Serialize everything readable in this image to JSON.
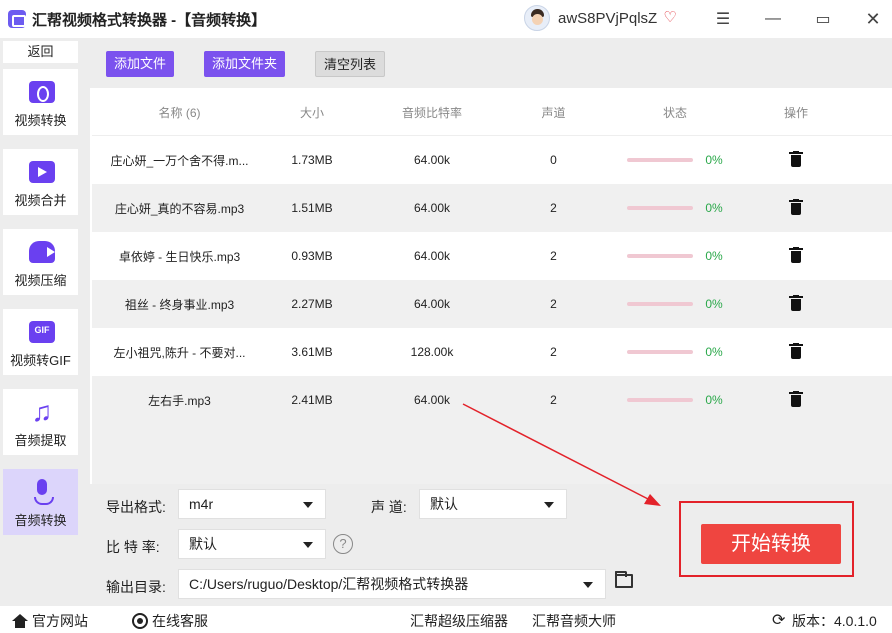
{
  "window": {
    "title": "汇帮视频格式转换器 -【音频转换】",
    "username": "awS8PVjPqlsZ",
    "icons": [
      "app-logo-icon",
      "avatar",
      "vip-heart-icon",
      "menu-icon",
      "minimize-icon",
      "maximize-icon",
      "close-icon"
    ]
  },
  "sidebar": {
    "back_label": "返回",
    "items": [
      {
        "label": "视频转换",
        "icon": "video-convert-icon"
      },
      {
        "label": "视频合并",
        "icon": "video-merge-icon"
      },
      {
        "label": "视频压缩",
        "icon": "video-compress-icon"
      },
      {
        "label": "视频转GIF",
        "icon": "gif-icon"
      },
      {
        "label": "音频提取",
        "icon": "music-note-icon"
      },
      {
        "label": "音频转换",
        "icon": "microphone-icon",
        "active": true
      }
    ]
  },
  "toolbar": {
    "add_file": "添加文件",
    "add_folder": "添加文件夹",
    "clear_list": "清空列表"
  },
  "table": {
    "headers": {
      "name": "名称 (6)",
      "size": "大小",
      "bitrate": "音频比特率",
      "channels": "声道",
      "status": "状态",
      "action": "操作"
    },
    "rows": [
      {
        "name": "庄心妍_一万个舍不得.m...",
        "size": "1.73MB",
        "bitrate": "64.00k",
        "channels": "0",
        "progress": "0%"
      },
      {
        "name": "庄心妍_真的不容易.mp3",
        "size": "1.51MB",
        "bitrate": "64.00k",
        "channels": "2",
        "progress": "0%"
      },
      {
        "name": "卓依婷 - 生日快乐.mp3",
        "size": "0.93MB",
        "bitrate": "64.00k",
        "channels": "2",
        "progress": "0%"
      },
      {
        "name": "祖丝 - 终身事业.mp3",
        "size": "2.27MB",
        "bitrate": "64.00k",
        "channels": "2",
        "progress": "0%"
      },
      {
        "name": "左小祖咒,陈升 - 不要对...",
        "size": "3.61MB",
        "bitrate": "128.00k",
        "channels": "2",
        "progress": "0%"
      },
      {
        "name": "左右手.mp3",
        "size": "2.41MB",
        "bitrate": "64.00k",
        "channels": "2",
        "progress": "0%"
      }
    ]
  },
  "settings": {
    "format_label": "导出格式:",
    "format_value": "m4r",
    "channel_label": "声 道:",
    "channel_value": "默认",
    "bitrate_label": "比 特 率:",
    "bitrate_value": "默认",
    "help_symbol": "?",
    "output_label": "输出目录:",
    "output_value": "C:/Users/ruguo/Desktop/汇帮视频格式转换器"
  },
  "start_button": "开始转换",
  "footer": {
    "website": "官方网站",
    "support": "在线客服",
    "compressor": "汇帮超级压缩器",
    "audio_master": "汇帮音频大师",
    "version": "版本：4.0.1.0"
  },
  "colors": {
    "accent": "#7b52ee",
    "start": "#ef4540",
    "highlight": "#e3222a",
    "progress_text": "#2aa84a"
  }
}
